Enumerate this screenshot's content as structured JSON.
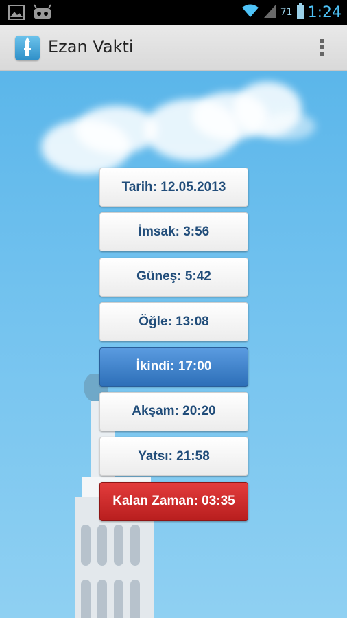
{
  "status_bar": {
    "battery_percent": "71",
    "time": "1:24"
  },
  "action_bar": {
    "title": "Ezan Vakti"
  },
  "prayer_times": [
    {
      "label": "Tarih: 12.05.2013",
      "state": "normal"
    },
    {
      "label": "İmsak: 3:56",
      "state": "normal"
    },
    {
      "label": "Güneş: 5:42",
      "state": "normal"
    },
    {
      "label": "Öğle: 13:08",
      "state": "normal"
    },
    {
      "label": "İkindi: 17:00",
      "state": "active"
    },
    {
      "label": "Akşam: 20:20",
      "state": "normal"
    },
    {
      "label": "Yatsı: 21:58",
      "state": "normal"
    },
    {
      "label": "Kalan Zaman: 03:35",
      "state": "remaining"
    }
  ],
  "colors": {
    "active": "#3b7fcc",
    "remaining": "#cc2a2a",
    "text": "#214d7a",
    "clock": "#4fc3f7"
  }
}
